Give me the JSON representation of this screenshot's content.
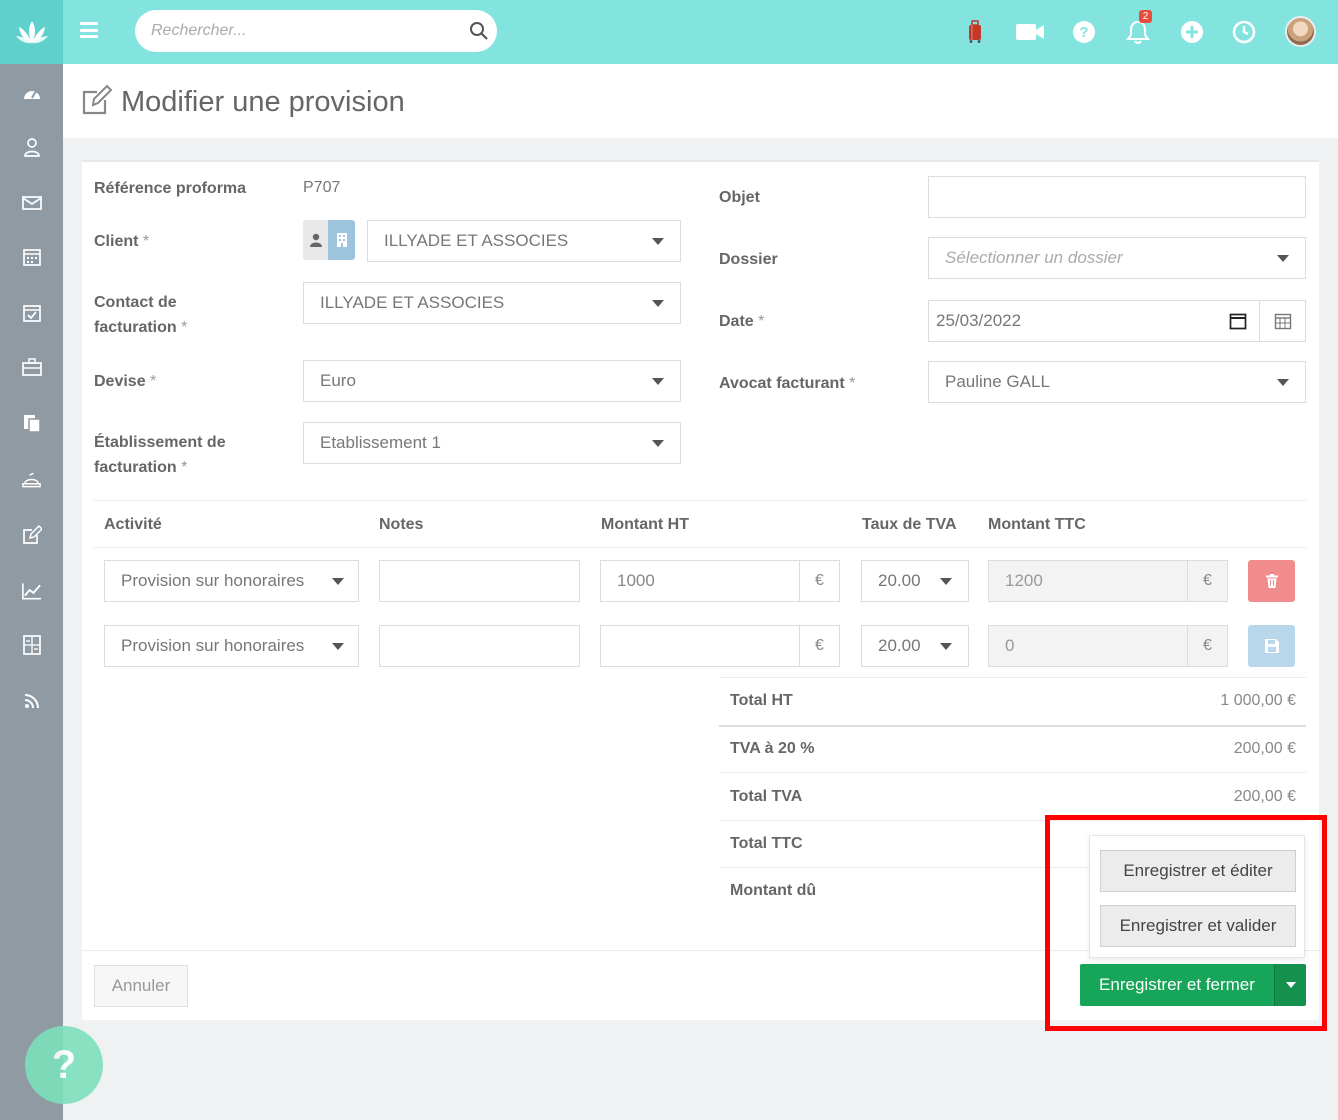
{
  "header": {
    "search_placeholder": "Rechercher...",
    "notifications_count": "2"
  },
  "page": {
    "title": "Modifier une provision"
  },
  "form": {
    "reference_label": "Référence proforma",
    "reference_value": "P707",
    "client_label": "Client",
    "client_value": "ILLYADE ET ASSOCIES",
    "contact_label_1": "Contact de",
    "contact_label_2": "facturation",
    "contact_value": "ILLYADE ET ASSOCIES",
    "devise_label": "Devise",
    "devise_value": "Euro",
    "etab_label_1": "Établissement de",
    "etab_label_2": "facturation",
    "etab_value": "Etablissement 1",
    "objet_label": "Objet",
    "objet_value": "",
    "dossier_label": "Dossier",
    "dossier_placeholder": "Sélectionner un dossier",
    "date_label": "Date",
    "date_value": "25/03/2022",
    "avocat_label": "Avocat facturant",
    "avocat_value": "Pauline GALL",
    "required_mark": "*"
  },
  "table": {
    "headers": [
      "Activité",
      "Notes",
      "Montant HT",
      "Taux de TVA",
      "Montant TTC"
    ],
    "currency": "€",
    "rows": [
      {
        "activite": "Provision sur honoraires",
        "notes": "",
        "montant_ht": "1000",
        "tva": "20.00",
        "montant_ttc": "1200",
        "action": "delete"
      },
      {
        "activite": "Provision sur honoraires",
        "notes": "",
        "montant_ht": "",
        "tva": "20.00",
        "montant_ttc": "0",
        "action": "save"
      }
    ]
  },
  "totals": {
    "total_ht_label": "Total HT",
    "total_ht_value": "1 000,00 €",
    "tva20_label": "TVA à 20 %",
    "tva20_value": "200,00 €",
    "total_tva_label": "Total TVA",
    "total_tva_value": "200,00 €",
    "total_ttc_label": "Total TTC",
    "montant_du_label": "Montant dû"
  },
  "actions": {
    "cancel": "Annuler",
    "save_edit": "Enregistrer et éditer",
    "save_validate": "Enregistrer et valider",
    "save_close": "Enregistrer et fermer"
  },
  "help": {
    "label": "?"
  },
  "colors": {
    "topbar": "#82e3df",
    "sidebar": "#8f9aa3",
    "primary_green": "#17a659",
    "delete_red": "#f08c8c",
    "save_blue": "#b9d7ea",
    "highlight": "#ff0000"
  },
  "icons": {
    "sidebar": [
      "dashboard-icon",
      "contacts-icon",
      "mail-icon",
      "calendar-icon",
      "tasks-icon",
      "briefcase-icon",
      "documents-icon",
      "billing-icon",
      "edit-icon",
      "chart-icon",
      "calculator-icon",
      "rss-icon"
    ],
    "topbar": [
      "luggage-icon",
      "video-icon",
      "help-icon",
      "bell-icon",
      "plus-icon",
      "clock-icon"
    ]
  }
}
